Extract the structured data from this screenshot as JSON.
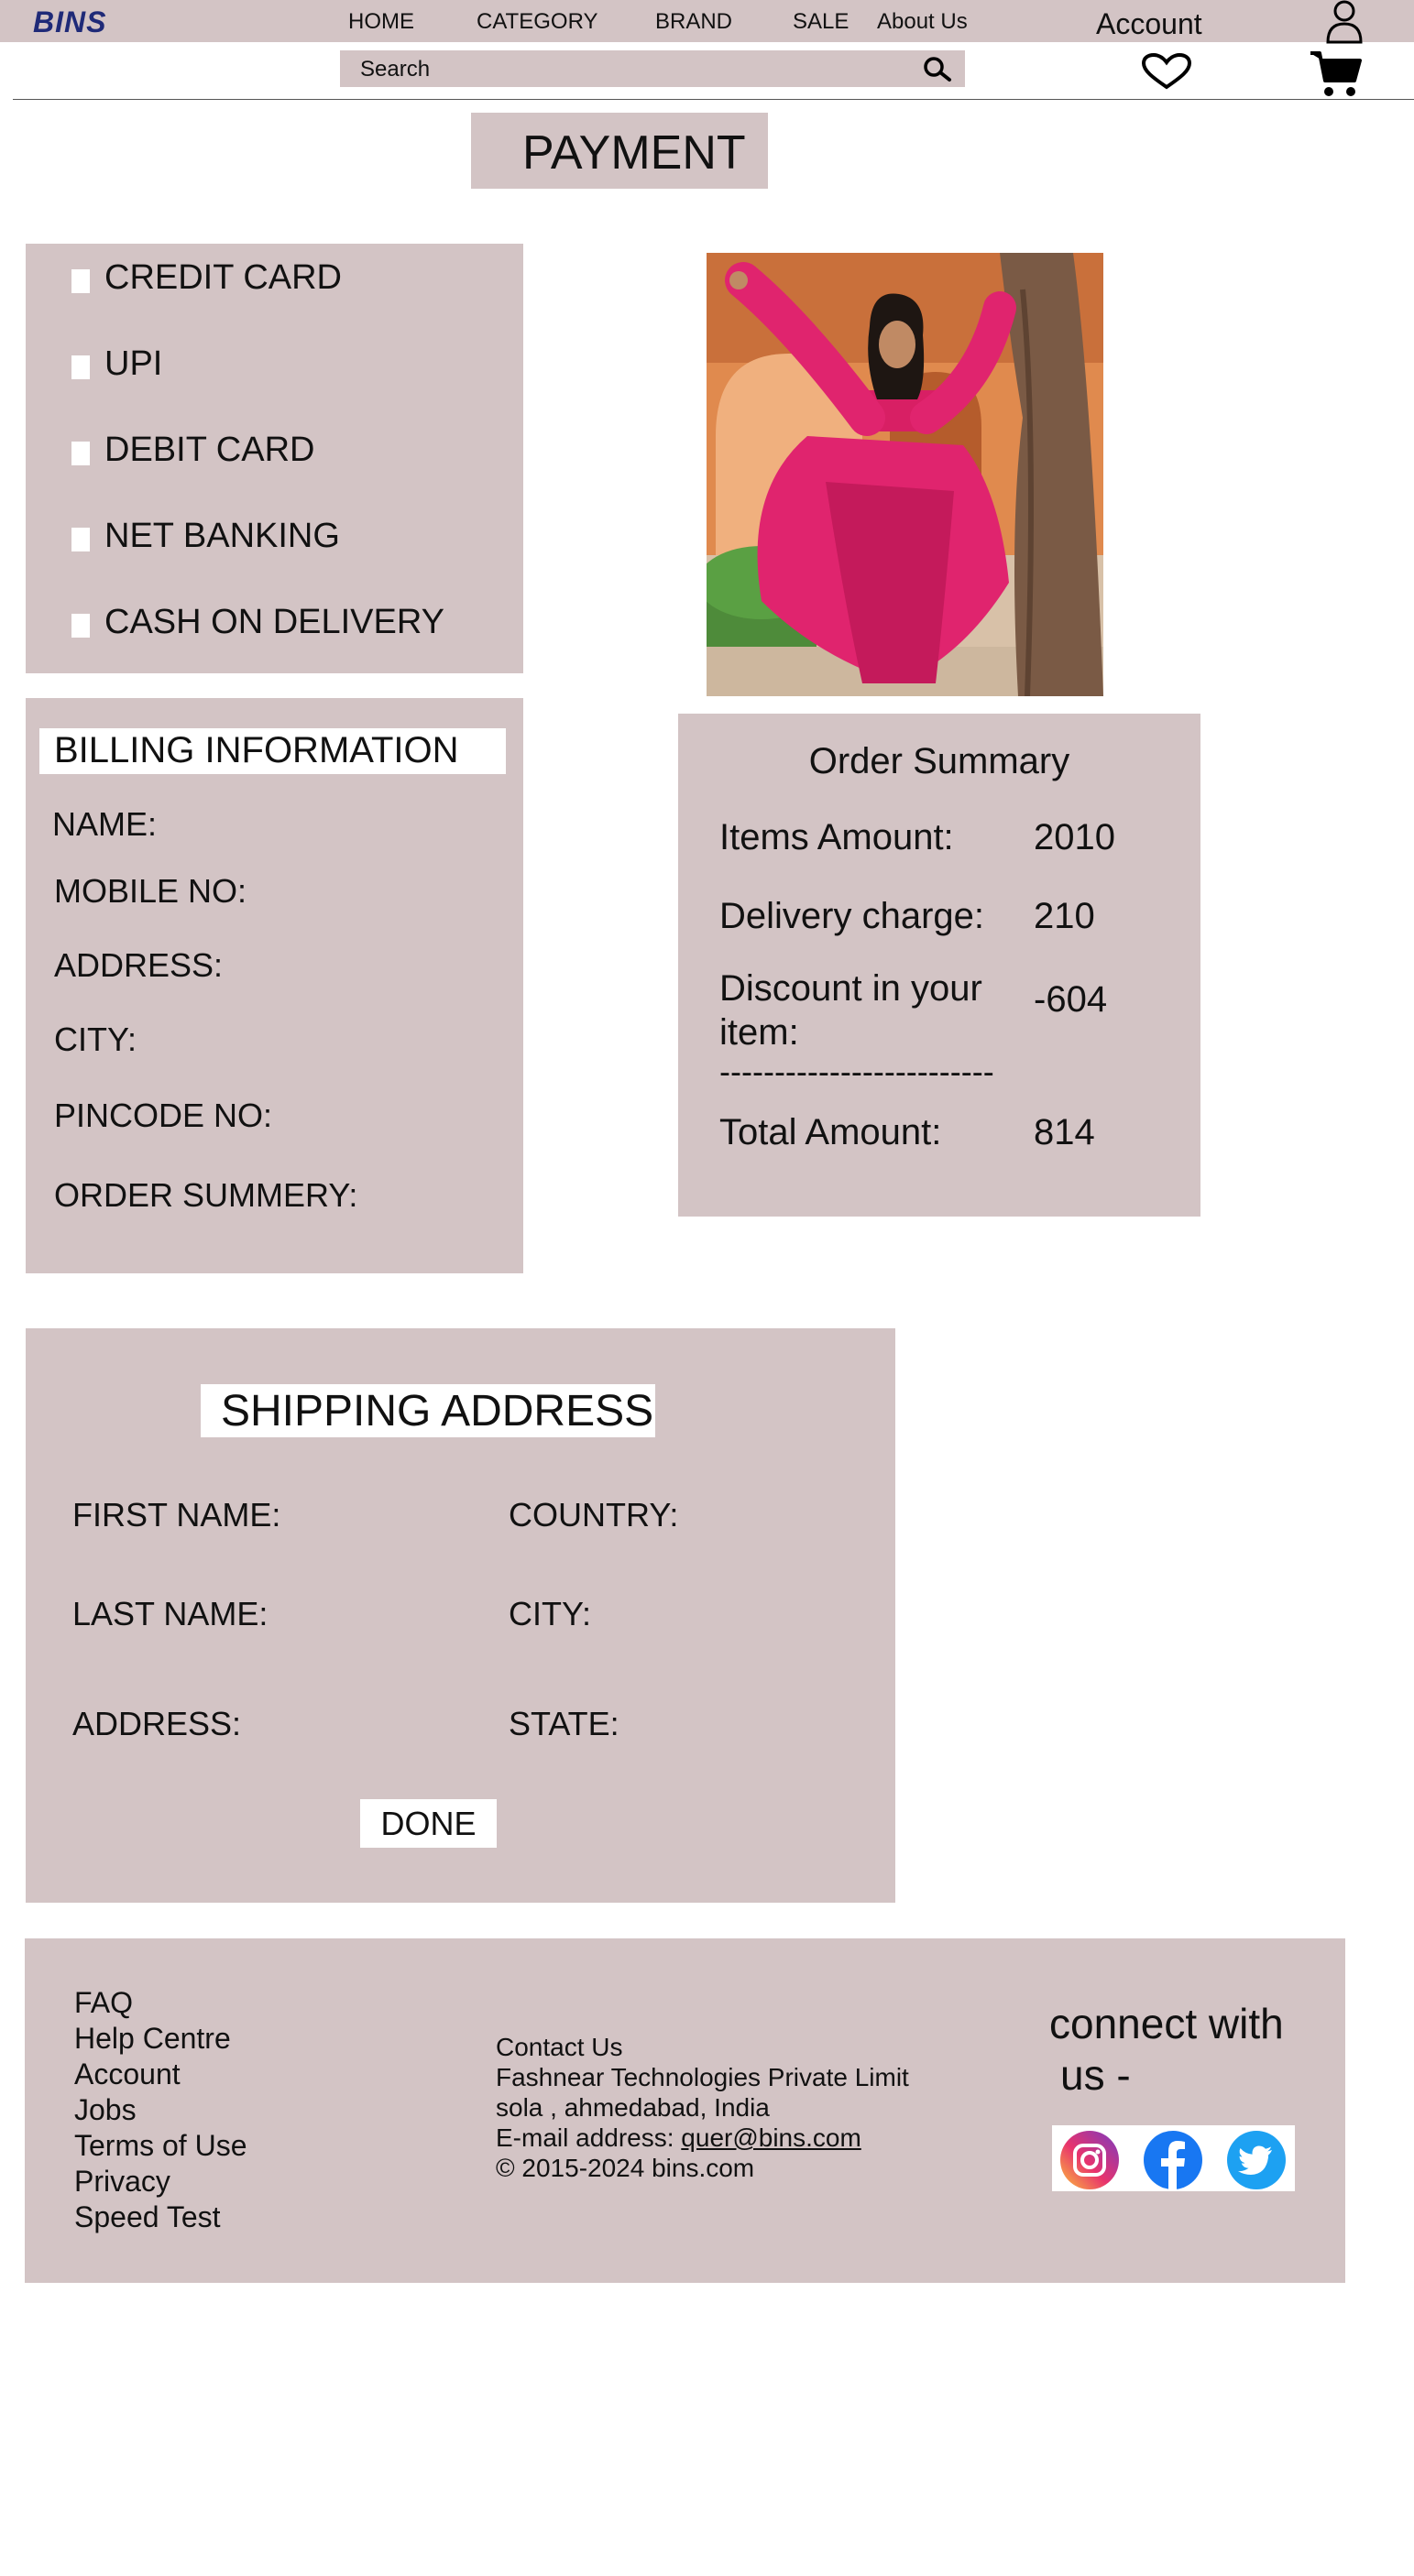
{
  "header": {
    "logo": "BINS",
    "nav": [
      "HOME",
      "CATEGORY",
      "BRAND",
      "SALE",
      "About Us"
    ],
    "account_label": "Account",
    "search_placeholder": "Search"
  },
  "page_title": "PAYMENT",
  "payment_options": [
    "CREDIT CARD",
    "UPI",
    "DEBIT CARD",
    "NET BANKING",
    "CASH ON DELIVERY"
  ],
  "billing": {
    "title": "BILLING INFORMATION",
    "fields": [
      "NAME:",
      "MOBILE NO:",
      "ADDRESS:",
      "CITY:",
      "PINCODE NO:",
      "ORDER SUMMERY:"
    ]
  },
  "order_summary": {
    "title": "Order Summary",
    "rows": [
      {
        "label": "Items Amount:",
        "value": "2010"
      },
      {
        "label": "Delivery charge:",
        "value": "210"
      },
      {
        "label": "Discount in your item:",
        "value": "-604"
      }
    ],
    "separator": "-------------------------",
    "total_label": "Total Amount:",
    "total_value": "814"
  },
  "shipping": {
    "title": "SHIPPING ADDRESS",
    "left_fields": [
      "FIRST NAME:",
      "LAST NAME:",
      "ADDRESS:"
    ],
    "right_fields": [
      "COUNTRY:",
      "CITY:",
      "STATE:"
    ],
    "done_label": "DONE"
  },
  "footer": {
    "links": [
      "FAQ",
      "Help Centre",
      "Account",
      "Jobs",
      "Terms of Use",
      "Privacy",
      "Speed Test"
    ],
    "contact": {
      "heading": "Contact Us",
      "company": "Fashnear Technologies Private Limit",
      "location": "sola , ahmedabad, India",
      "email_prefix": "E-mail address: ",
      "email": "quer@bins.com",
      "copyright": "© 2015-2024 bins.com"
    },
    "connect_line1": "connect with",
    "connect_line2": "us -",
    "social_icons": [
      "instagram-icon",
      "facebook-icon",
      "twitter-icon"
    ]
  },
  "colors": {
    "panel": "#d3c4c5",
    "logo": "#1f2a78",
    "dress_pink": "#e0246e"
  }
}
